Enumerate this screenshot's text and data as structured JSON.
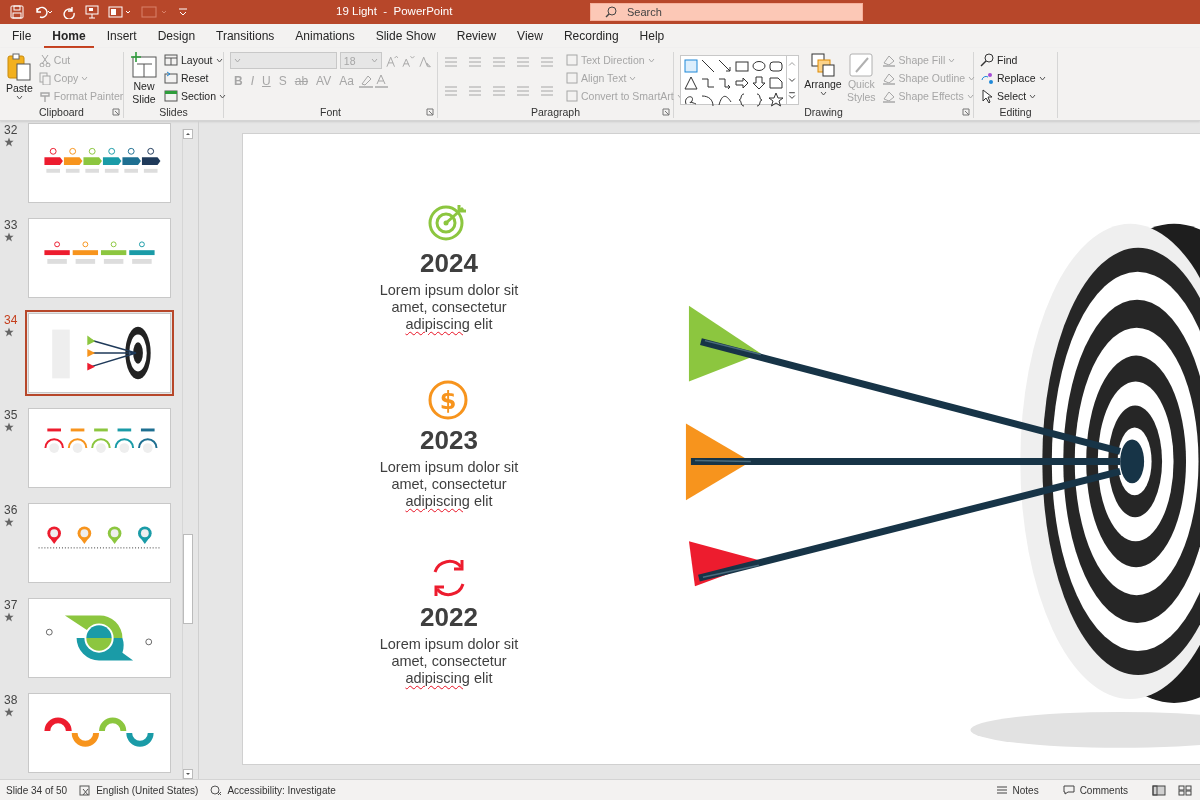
{
  "window": {
    "title": "19 Light  -  PowerPoint",
    "search": {
      "placeholder": "Search"
    }
  },
  "tabs": [
    {
      "label": "File",
      "selected": false
    },
    {
      "label": "Home",
      "selected": true
    },
    {
      "label": "Insert",
      "selected": false
    },
    {
      "label": "Design",
      "selected": false
    },
    {
      "label": "Transitions",
      "selected": false
    },
    {
      "label": "Animations",
      "selected": false
    },
    {
      "label": "Slide Show",
      "selected": false
    },
    {
      "label": "Review",
      "selected": false
    },
    {
      "label": "View",
      "selected": false
    },
    {
      "label": "Recording",
      "selected": false
    },
    {
      "label": "Help",
      "selected": false
    }
  ],
  "ribbon": {
    "clipboard": {
      "label": "Clipboard",
      "paste": "Paste",
      "items": [
        {
          "label": "Cut",
          "disabled": true
        },
        {
          "label": "Copy",
          "disabled": true
        },
        {
          "label": "Format Painter",
          "disabled": true
        }
      ]
    },
    "slides": {
      "label": "Slides",
      "new_slide": "New Slide",
      "items": [
        {
          "label": "Layout",
          "disabled": false
        },
        {
          "label": "Reset",
          "disabled": false
        },
        {
          "label": "Section",
          "disabled": false
        }
      ]
    },
    "font": {
      "label": "Font",
      "size": "18",
      "disabled": true,
      "buttons": [
        "B",
        "I",
        "U",
        "S",
        "ab",
        "AV",
        "Aa"
      ]
    },
    "paragraph": {
      "label": "Paragraph",
      "items": [
        {
          "label": "Text Direction",
          "disabled": true
        },
        {
          "label": "Align Text",
          "disabled": true
        },
        {
          "label": "Convert to SmartArt",
          "disabled": true
        }
      ]
    },
    "drawing": {
      "label": "Drawing",
      "arrange": "Arrange",
      "quick_styles": {
        "label": "Quick Styles",
        "disabled": true
      },
      "items": [
        {
          "label": "Shape Fill",
          "disabled": true
        },
        {
          "label": "Shape Outline",
          "disabled": true
        },
        {
          "label": "Shape Effects",
          "disabled": true
        }
      ]
    },
    "editing": {
      "label": "Editing",
      "items": [
        {
          "label": "Find",
          "disabled": false
        },
        {
          "label": "Replace",
          "disabled": false
        },
        {
          "label": "Select",
          "disabled": false
        }
      ]
    }
  },
  "thumbnails": [
    {
      "number": "32",
      "kind": "arrows",
      "selected": false
    },
    {
      "number": "33",
      "kind": "banners",
      "selected": false
    },
    {
      "number": "34",
      "kind": "target",
      "selected": true
    },
    {
      "number": "35",
      "kind": "arches",
      "selected": false
    },
    {
      "number": "36",
      "kind": "pins",
      "selected": false
    },
    {
      "number": "37",
      "kind": "cycle",
      "selected": false
    },
    {
      "number": "38",
      "kind": "waves",
      "selected": false
    }
  ],
  "slide": {
    "items": [
      {
        "kind": "target",
        "color": "#8cc63f",
        "year": "2024",
        "text": "Lorem ipsum dolor sit amet, consectetur",
        "flagged": "adipiscing",
        "tail": "elit"
      },
      {
        "kind": "dollar",
        "symbol": "$",
        "color": "#f7941d",
        "year": "2023",
        "text": "Lorem ipsum dolor sit amet, consectetur",
        "flagged": "adipiscing",
        "tail": "elit"
      },
      {
        "kind": "cycle",
        "color": "#ed1c2e",
        "year": "2022",
        "text": "Lorem ipsum dolor sit amet, consectetur",
        "flagged": "adipiscing",
        "tail": "elit"
      }
    ]
  },
  "status_bar": {
    "slide": "Slide 34 of 50",
    "language": "English (United States)",
    "accessibility": "Accessibility: Investigate",
    "notes": "Notes",
    "comments": "Comments"
  }
}
